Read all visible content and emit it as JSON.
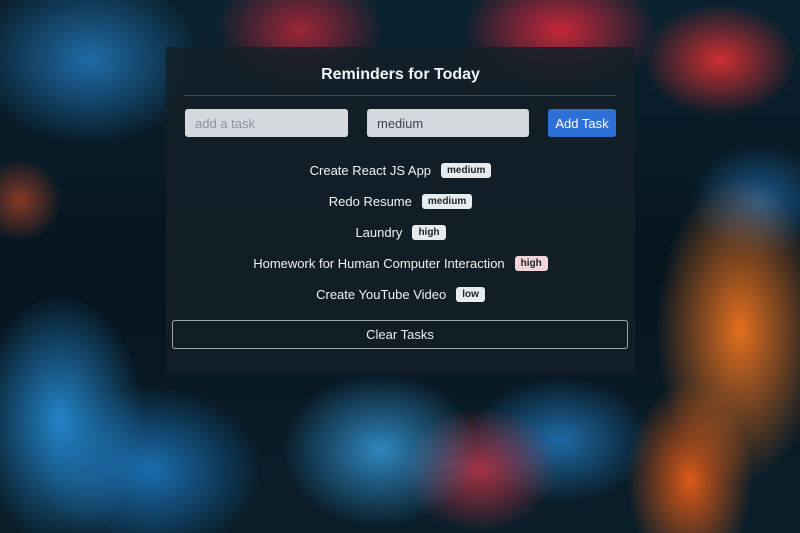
{
  "app": {
    "title": "Reminders for Today"
  },
  "form": {
    "task_placeholder": "add a task",
    "task_value": "",
    "priority_value": "medium",
    "add_label": "Add Task"
  },
  "tasks": [
    {
      "text": "Create React JS App",
      "priority": "medium"
    },
    {
      "text": "Redo Resume",
      "priority": "medium"
    },
    {
      "text": "Laundry",
      "priority": "high"
    },
    {
      "text": "Homework for Human Computer Interaction",
      "priority": "high"
    },
    {
      "text": "Create YouTube Video",
      "priority": "low"
    }
  ],
  "clear_label": "Clear Tasks",
  "colors": {
    "accent": "#2f6fd8",
    "card_bg": "#142028"
  }
}
